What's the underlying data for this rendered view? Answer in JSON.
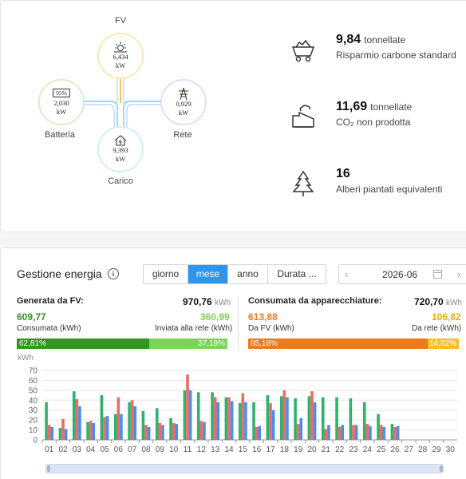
{
  "flow": {
    "fv": {
      "label": "FV",
      "value": "6,434",
      "unit": "kW"
    },
    "battery": {
      "label": "Batteria",
      "percent": "95%",
      "value": "2,030",
      "unit": "kW"
    },
    "grid": {
      "label": "Rete",
      "value": "0,929",
      "unit": "kW"
    },
    "load": {
      "label": "Carico",
      "value": "9,393",
      "unit": "kW"
    }
  },
  "stats": [
    {
      "value": "9,84",
      "unit": "tonnellate",
      "desc": "Risparmio carbone standard",
      "icon": "coal-cart-icon"
    },
    {
      "value": "11,69",
      "unit": "tonnellate",
      "desc": "CO₂ non prodotta",
      "icon": "factory-icon"
    },
    {
      "value": "16",
      "unit": "",
      "desc": "Alberi piantati equivalenti",
      "icon": "tree-icon"
    }
  ],
  "energy": {
    "title": "Gestione energia",
    "periods": [
      "giorno",
      "mese",
      "anno",
      "Durata ..."
    ],
    "active_period": "mese",
    "date": "2026-06",
    "generated": {
      "label": "Generata da FV:",
      "total": "970,76",
      "unit": "kWh",
      "consumed": "609,77",
      "consumed_label": "Consumata (kWh)",
      "sent": "360,99",
      "sent_label": "Inviata alla rete (kWh)",
      "pct_consumed": "62,81%",
      "pct_sent": "37,19%"
    },
    "consumed": {
      "label": "Consumata da apparecchiature:",
      "total": "720,70",
      "unit": "kWh",
      "from_pv": "613,88",
      "from_pv_label": "Da FV (kWh)",
      "from_grid": "106,82",
      "from_grid_label": "Da rete (kWh)",
      "pct_pv": "85,18%",
      "pct_grid": "14,82%"
    },
    "colors": {
      "green": "#2db36b",
      "red": "#ec6b63",
      "blue": "#4a8df0",
      "dark_green": "#33941f",
      "light_green": "#7fd157",
      "orange": "#ed7a1c",
      "yellow": "#f2c21d"
    }
  },
  "chart_data": {
    "type": "bar",
    "ylabel": "kWh",
    "ylim": [
      0,
      70
    ],
    "yticks": [
      0,
      10,
      20,
      30,
      40,
      50,
      60,
      70
    ],
    "categories": [
      "01",
      "02",
      "03",
      "04",
      "05",
      "06",
      "07",
      "08",
      "09",
      "10",
      "11",
      "12",
      "13",
      "14",
      "15",
      "16",
      "17",
      "18",
      "19",
      "20",
      "21",
      "22",
      "23",
      "24",
      "25",
      "26",
      "27",
      "28",
      "29",
      "30"
    ],
    "series": [
      {
        "color": "#2db36b",
        "values": [
          38,
          12,
          49,
          18,
          45,
          26,
          38,
          29,
          32,
          22,
          50,
          48,
          48,
          43,
          37,
          38,
          45,
          44,
          42,
          44,
          43,
          43,
          42,
          38,
          26,
          16,
          0,
          0,
          0,
          0
        ]
      },
      {
        "color": "#ec6b63",
        "values": [
          15,
          21,
          41,
          19,
          23,
          43,
          40,
          15,
          17,
          17,
          66,
          19,
          43,
          43,
          47,
          13,
          37,
          50,
          16,
          49,
          11,
          13,
          15,
          16,
          15,
          13,
          0,
          0,
          0,
          0
        ]
      },
      {
        "color": "#4a8df0",
        "values": [
          13,
          11,
          34,
          17,
          24,
          26,
          34,
          13,
          15,
          16,
          50,
          18,
          38,
          39,
          38,
          14,
          30,
          43,
          22,
          38,
          15,
          15,
          15,
          14,
          13,
          14,
          0,
          0,
          0,
          0
        ]
      }
    ]
  }
}
